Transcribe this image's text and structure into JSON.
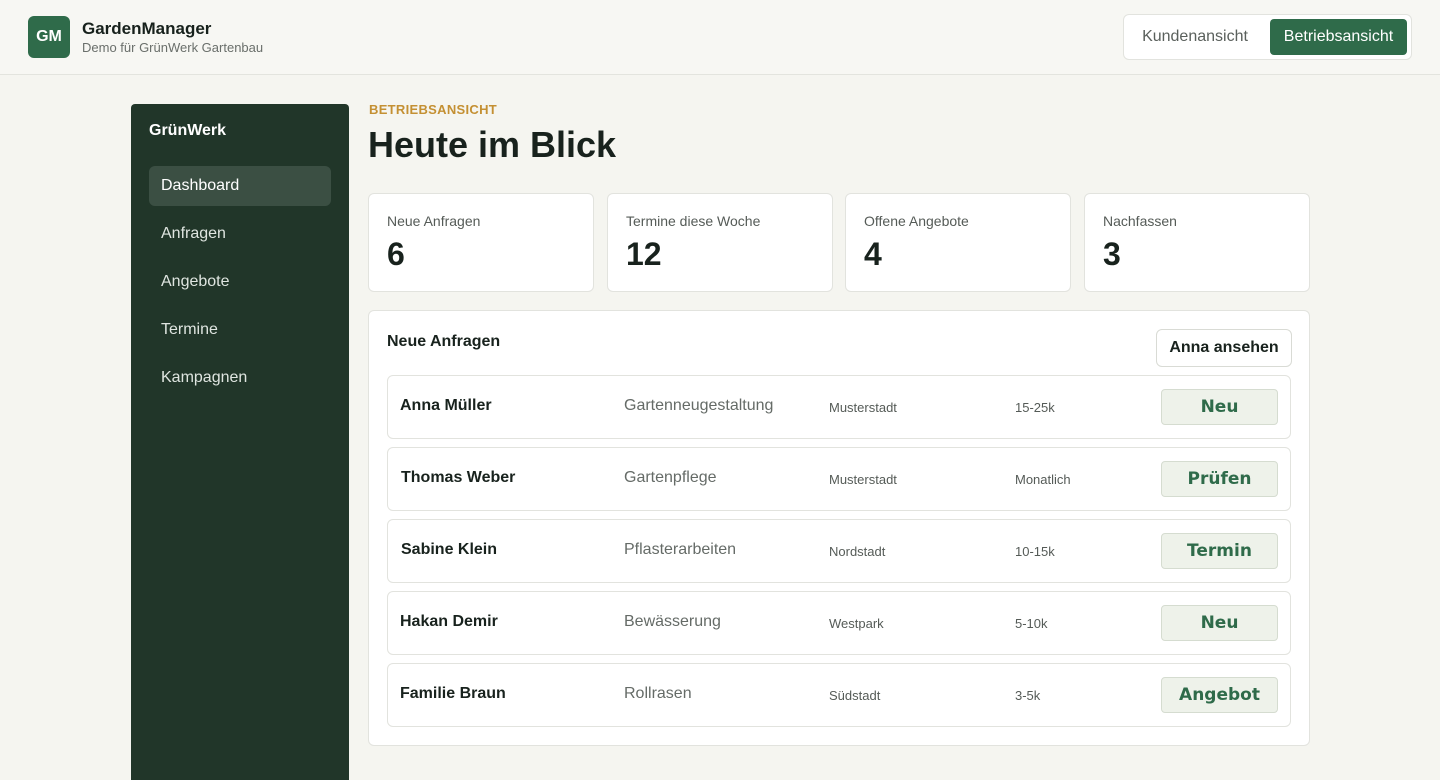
{
  "header": {
    "logo_text": "GM",
    "app_name": "GardenManager",
    "subtitle": "Demo für GrünWerk Gartenbau",
    "toggle": {
      "customer_view": "Kundenansicht",
      "business_view": "Betriebsansicht",
      "selected": "Betriebsansicht"
    }
  },
  "sidebar": {
    "brand": "GrünWerk",
    "items": [
      {
        "label": "Dashboard",
        "active": true
      },
      {
        "label": "Anfragen",
        "active": false
      },
      {
        "label": "Angebote",
        "active": false
      },
      {
        "label": "Termine",
        "active": false
      },
      {
        "label": "Kampagnen",
        "active": false
      }
    ]
  },
  "main": {
    "eyebrow": "BETRIEBSANSICHT",
    "title": "Heute im Blick",
    "kpis": [
      {
        "label": "Neue Anfragen",
        "value": "6"
      },
      {
        "label": "Termine diese Woche",
        "value": "12"
      },
      {
        "label": "Offene Angebote",
        "value": "4"
      },
      {
        "label": "Nachfassen",
        "value": "3"
      }
    ],
    "panel": {
      "title": "Neue Anfragen",
      "action_label": "Anna ansehen",
      "rows": [
        {
          "name": "Anna Müller",
          "service": "Gartenneugestaltung",
          "city": "Musterstadt",
          "budget": "15-25k",
          "status": "Neu"
        },
        {
          "name": "Thomas Weber",
          "service": "Gartenpflege",
          "city": "Musterstadt",
          "budget": "Monatlich",
          "status": "Prüfen"
        },
        {
          "name": "Sabine Klein",
          "service": "Pflasterarbeiten",
          "city": "Nordstadt",
          "budget": "10-15k",
          "status": "Termin"
        },
        {
          "name": "Hakan Demir",
          "service": "Bewässerung",
          "city": "Westpark",
          "budget": "5-10k",
          "status": "Neu"
        },
        {
          "name": "Familie Braun",
          "service": "Rollrasen",
          "city": "Südstadt",
          "budget": "3-5k",
          "status": "Angebot"
        }
      ]
    }
  },
  "colors": {
    "brand_green": "#2f6b4a",
    "sidebar_bg": "#213629",
    "accent_gold": "#c49033",
    "page_bg": "#f5f5f0"
  }
}
